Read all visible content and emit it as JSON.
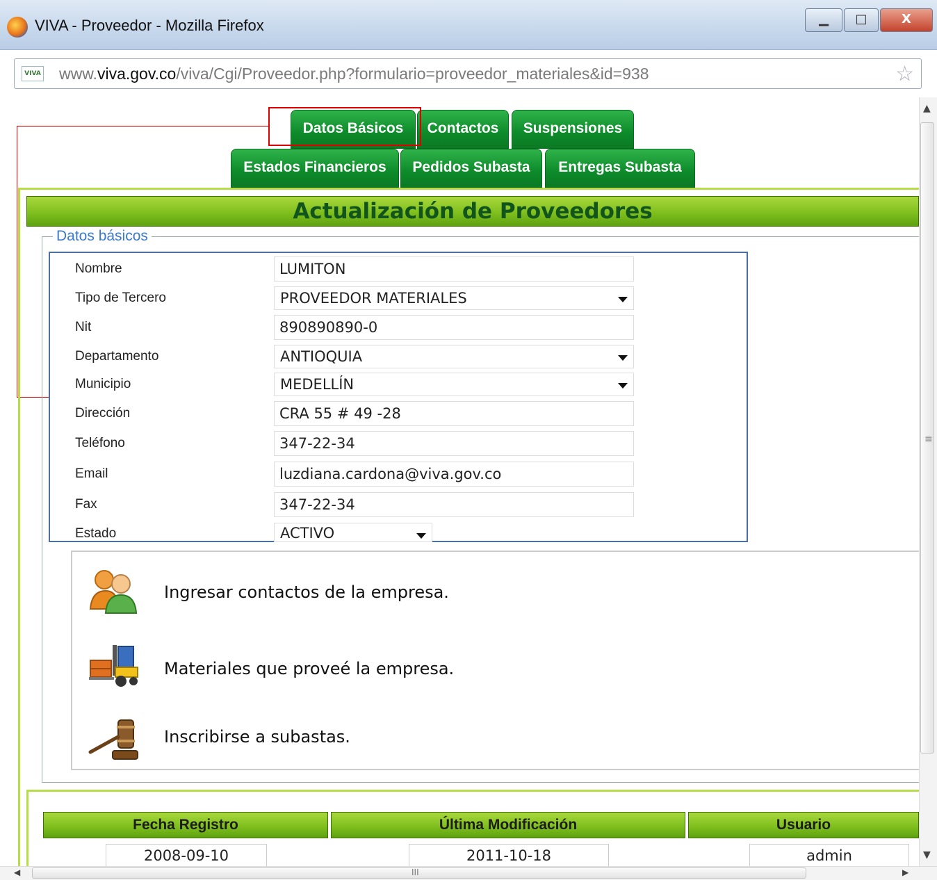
{
  "window": {
    "title": "VIVA - Proveedor - Mozilla Firefox",
    "minimize_glyph": "▁",
    "maximize_glyph": "□",
    "close_glyph": "X"
  },
  "urlbar": {
    "site_badge": "VIVA",
    "url_prefix": "www.",
    "url_domain": "viva.gov.co",
    "url_path": "/viva/Cgi/Proveedor.php?formulario=proveedor_materiales&id=938",
    "star_glyph": "☆"
  },
  "tabs": {
    "row1": [
      "Datos Básicos",
      "Contactos",
      "Suspensiones"
    ],
    "row2": [
      "Estados Financieros",
      "Pedidos Subasta",
      "Entregas Subasta"
    ]
  },
  "header": {
    "title": "Actualización de Proveedores"
  },
  "fieldset": {
    "legend": "Datos básicos"
  },
  "form": {
    "nombre": {
      "label": "Nombre",
      "value": "LUMITON"
    },
    "tipo": {
      "label": "Tipo de Tercero",
      "value": "PROVEEDOR MATERIALES"
    },
    "nit": {
      "label": "Nit",
      "value": "890890890-0"
    },
    "departamento": {
      "label": "Departamento",
      "value": "ANTIOQUIA"
    },
    "municipio": {
      "label": "Municipio",
      "value": "MEDELLÍN"
    },
    "direccion": {
      "label": "Dirección",
      "value": "CRA 55 # 49 -28"
    },
    "telefono": {
      "label": "Teléfono",
      "value": "347-22-34"
    },
    "email": {
      "label": "Email",
      "value": "luzdiana.cardona@viva.gov.co"
    },
    "fax": {
      "label": "Fax",
      "value": "347-22-34"
    },
    "estado": {
      "label": "Estado",
      "value": "ACTIVO"
    }
  },
  "actions": {
    "contactos": "Ingresar contactos de la empresa.",
    "materiales": "Materiales que proveé la empresa.",
    "subastas": "Inscribirse a subastas."
  },
  "registro": {
    "fecha_head": "Fecha Registro",
    "ultima_head": "Última Modificación",
    "usuario_head": "Usuario",
    "fecha_val": "2008-09-10",
    "ultima_val": "2011-10-18",
    "usuario_val": "admin"
  },
  "scroll": {
    "up": "▲",
    "down": "▼",
    "left": "◀",
    "right": "▶",
    "vgrip": "≡",
    "hgrip": "III"
  },
  "colors": {
    "tab_green": "#0d8a2a",
    "header_green": "#7fbf1e",
    "panel_border": "#b6dd45",
    "highlight_red": "#e00000",
    "title_green": "#11551c"
  }
}
